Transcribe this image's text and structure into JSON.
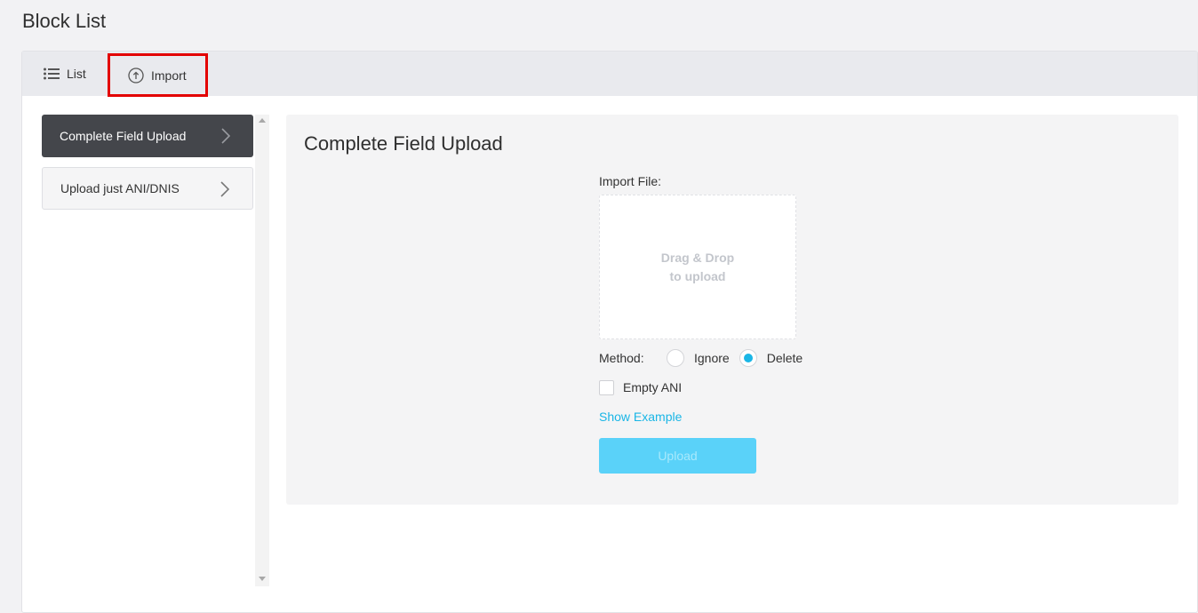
{
  "page": {
    "title": "Block List"
  },
  "tabs": [
    {
      "label": "List",
      "icon": "list-icon"
    },
    {
      "label": "Import",
      "icon": "upload-circle-icon",
      "highlighted": true
    }
  ],
  "sidebar": {
    "items": [
      {
        "label": "Complete Field Upload",
        "active": true
      },
      {
        "label": "Upload just ANI/DNIS",
        "active": false
      }
    ]
  },
  "content": {
    "title": "Complete Field Upload",
    "import_file_label": "Import File:",
    "dropzone": {
      "line1": "Drag & Drop",
      "line2": "to upload"
    },
    "method": {
      "label": "Method:",
      "options": [
        {
          "label": "Ignore",
          "selected": false
        },
        {
          "label": "Delete",
          "selected": true
        }
      ]
    },
    "empty_ani": {
      "label": "Empty ANI",
      "checked": false
    },
    "show_example_label": "Show Example",
    "upload_label": "Upload"
  },
  "colors": {
    "accent": "#1ab6e6",
    "upload_button": "#5ad2f9",
    "active_nav": "#44464b",
    "highlight_border": "#e30000"
  }
}
